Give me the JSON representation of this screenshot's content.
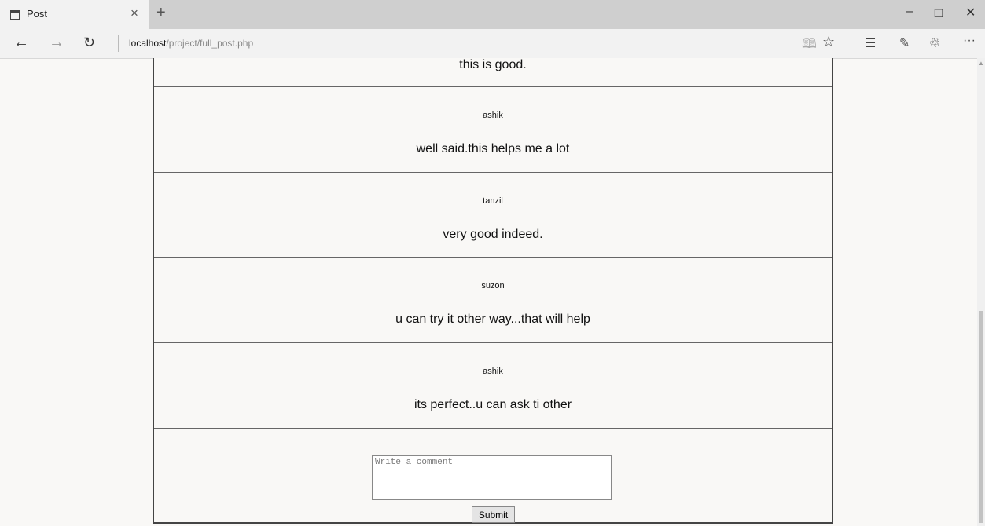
{
  "browser": {
    "tab_title": "Post",
    "tab_close": "×",
    "new_tab": "+",
    "window_controls": {
      "minimize": "–",
      "restore": "❐",
      "close": "✕"
    },
    "nav": {
      "back": "←",
      "forward": "→",
      "refresh": "↻"
    },
    "address": {
      "host": "localhost",
      "path": "/project/full_post.php"
    },
    "toolbar_icons": [
      "reading-view-icon",
      "favorite-star-icon",
      "hub-icon",
      "web-note-icon",
      "share-icon",
      "more-icon"
    ]
  },
  "comments": [
    {
      "author": "",
      "text": "this is good."
    },
    {
      "author": "ashik",
      "text": "well said.this helps me a lot"
    },
    {
      "author": "tanzil",
      "text": "very good indeed."
    },
    {
      "author": "suzon",
      "text": "u can try it other way...that will help"
    },
    {
      "author": "ashik",
      "text": "its perfect..u can ask ti other"
    }
  ],
  "comment_form": {
    "placeholder": "Write a comment",
    "submit_label": "Submit"
  }
}
